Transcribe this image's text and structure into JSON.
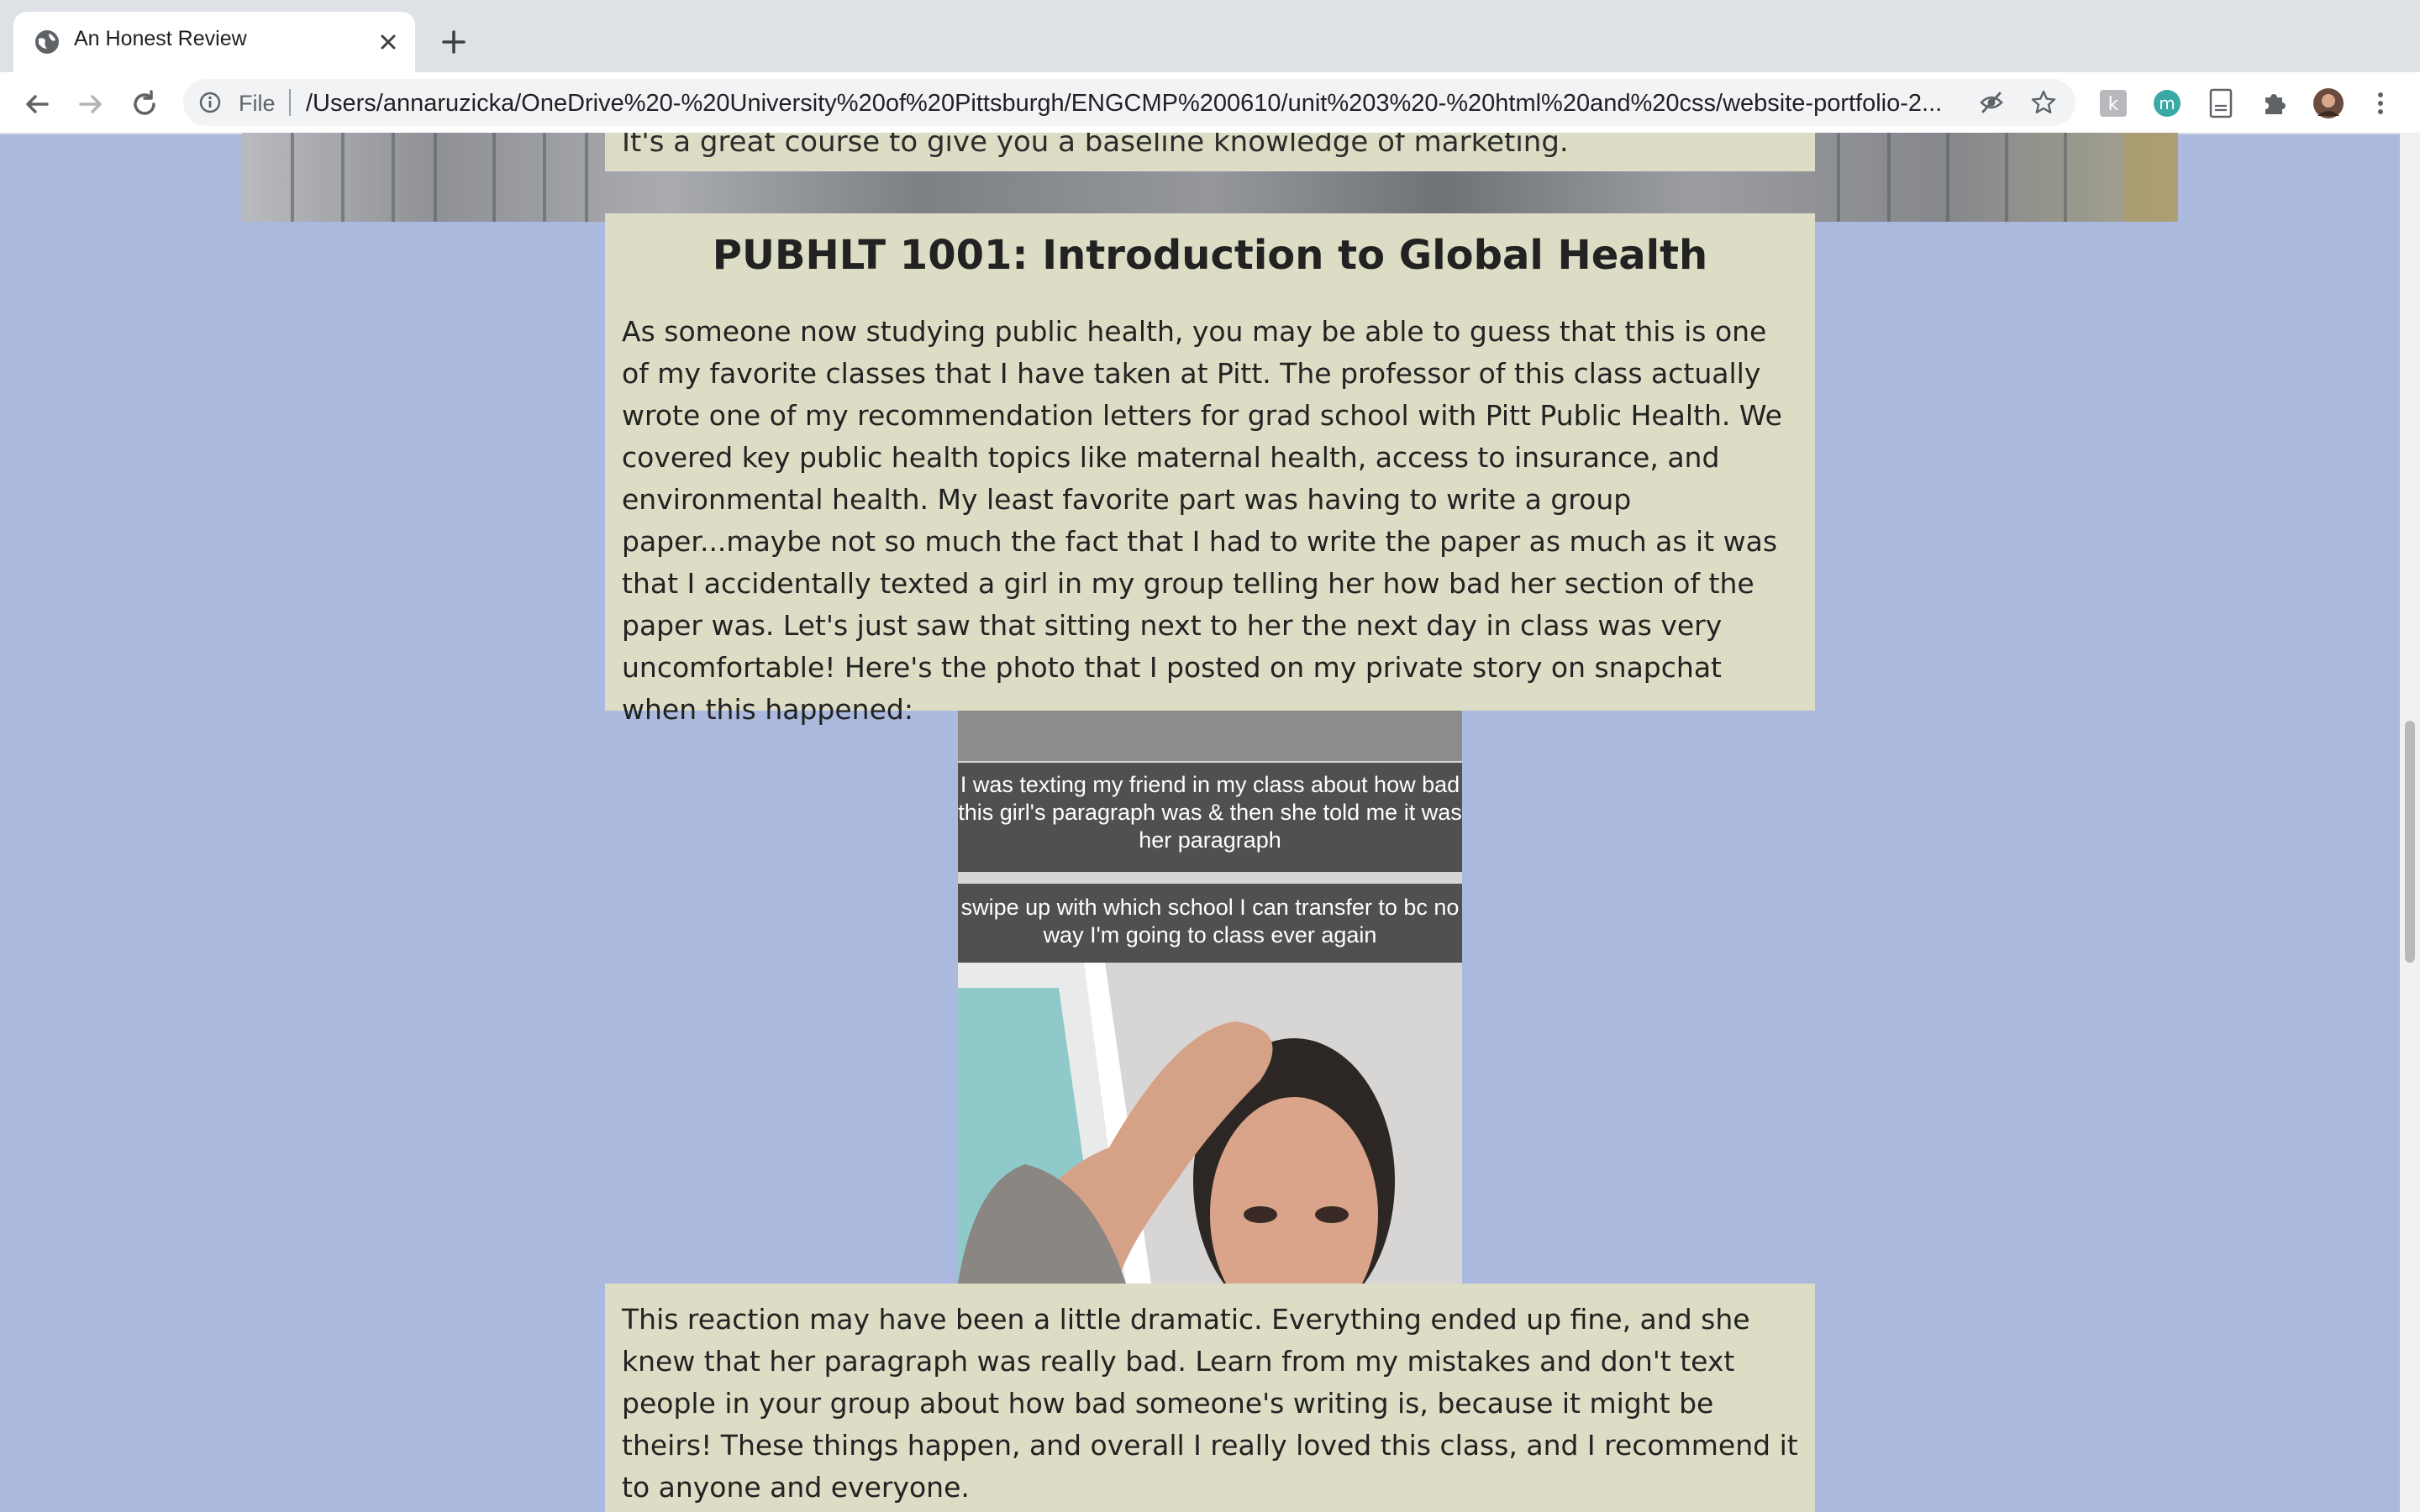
{
  "browser": {
    "tab_title": "An Honest Review",
    "file_label": "File",
    "url": "/Users/annaruzicka/OneDrive%20-%20University%20of%20Pittsburgh/ENGCMP%200610/unit%203%20-%20html%20and%20css/website-portfolio-2...",
    "extensions": [
      "k-extension-icon",
      "m-extension-icon",
      "document-extension-icon",
      "puzzle-extensions-icon",
      "profile-avatar"
    ],
    "extension_letters": {
      "k": "k",
      "m": "m"
    }
  },
  "page": {
    "top_card_text": "It's a great course to give you a baseline knowledge of marketing.",
    "course_title": "PUBHLT 1001: Introduction to Global Health",
    "course_paragraph": "As someone now studying public health, you may be able to guess that this is one of my favorite classes that I have taken at Pitt. The professor of this class actually wrote one of my recommendation letters for grad school with Pitt Public Health. We covered key public health topics like maternal health, access to insurance, and environmental health. My least favorite part was having to write a group paper...maybe not so much the fact that I had to write the paper as much as it was that I accidentally texted a girl in my group telling her how bad her section of the paper was. Let's just saw that sitting next to her the next day in class was very uncomfortable! Here's the photo that I posted on my private story on snapchat when this happened:",
    "snap_caption_1": "I was texting my friend in my class about how bad this girl's paragraph was & then she told me it was her paragraph",
    "snap_caption_2": "swipe up with which school I can transfer to bc no way I'm going to class ever again",
    "closing_paragraph": "This reaction may have been a little dramatic. Everything ended up fine, and she knew that her paragraph was really bad. Learn from my mistakes and don't text people in your group about how bad someone's writing is, because it might be theirs! These things happen, and overall I really loved this class, and I recommend it to anyone and everyone."
  },
  "colors": {
    "background": "#abb9df",
    "card": "#dddcc5",
    "tabbar": "#dee1e6"
  }
}
